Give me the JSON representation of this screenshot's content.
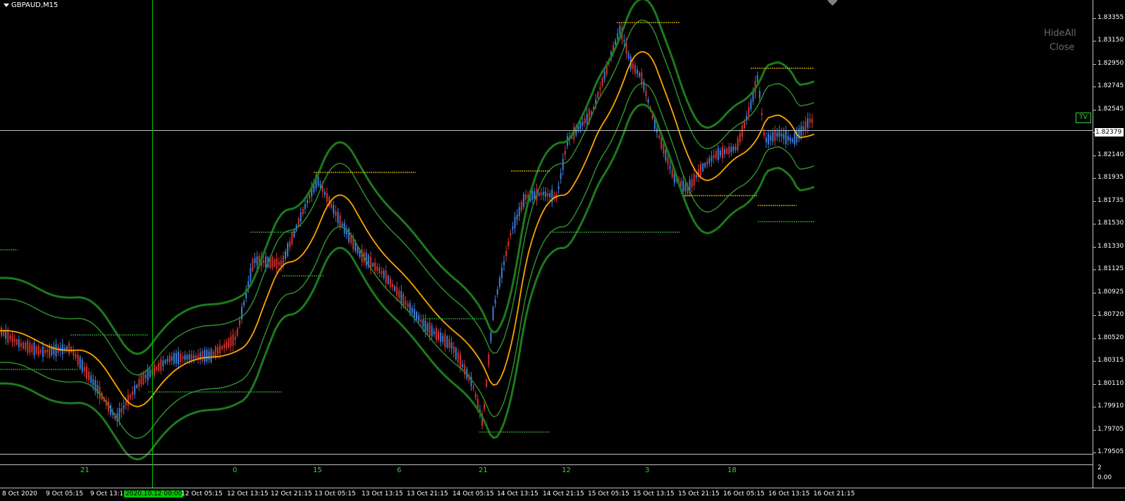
{
  "symbol": {
    "label": "GBPAUD,M15"
  },
  "buttons": {
    "hide_all": "HideAll",
    "close": "Close"
  },
  "tv_badge": "TV",
  "current_price": "1.82379",
  "price_axis": {
    "labels": [
      "1.83355",
      "1.83150",
      "1.82950",
      "1.82745",
      "1.82545",
      "1.82340",
      "1.82140",
      "1.81935",
      "1.81735",
      "1.81530",
      "1.81330",
      "1.81125",
      "1.80925",
      "1.80720",
      "1.80520",
      "1.80315",
      "1.80110",
      "1.79910",
      "1.79705",
      "1.79505"
    ],
    "min": 1.79505,
    "max": 1.83355
  },
  "sub_axis": {
    "top_label": "2",
    "bottom_label": "0.00"
  },
  "time_axis": {
    "labels": [
      "8 Oct 2020",
      "9 Oct 05:15",
      "9 Oct 13:15",
      "2020.10.12 00:00",
      "12 Oct 05:15",
      "12 Oct 13:15",
      "12 Oct 21:15",
      "13 Oct 05:15",
      "13 Oct 13:15",
      "13 Oct 21:15",
      "14 Oct 05:15",
      "14 Oct 13:15",
      "14 Oct 21:15",
      "15 Oct 05:15",
      "15 Oct 13:15",
      "15 Oct 21:15",
      "16 Oct 05:15",
      "16 Oct 13:15",
      "16 Oct 21:15"
    ],
    "highlighted": "2020.10.12 00:00"
  },
  "counters": [
    "21",
    "0",
    "15",
    "6",
    "21",
    "12",
    "3",
    "18"
  ],
  "colors": {
    "bull_candle": "#3b7dd8",
    "bear_candle": "#d0312d",
    "ma_line": "#ffa500",
    "band_outer": "#1c7a1c",
    "band_inner": "#2e8b2e",
    "level_line": "#b8a000",
    "crosshair": "#00c800",
    "counter_text": "#37d637"
  },
  "icons": {
    "menu_triangle": "triangle-down-icon",
    "marker": "diamond-icon"
  }
}
